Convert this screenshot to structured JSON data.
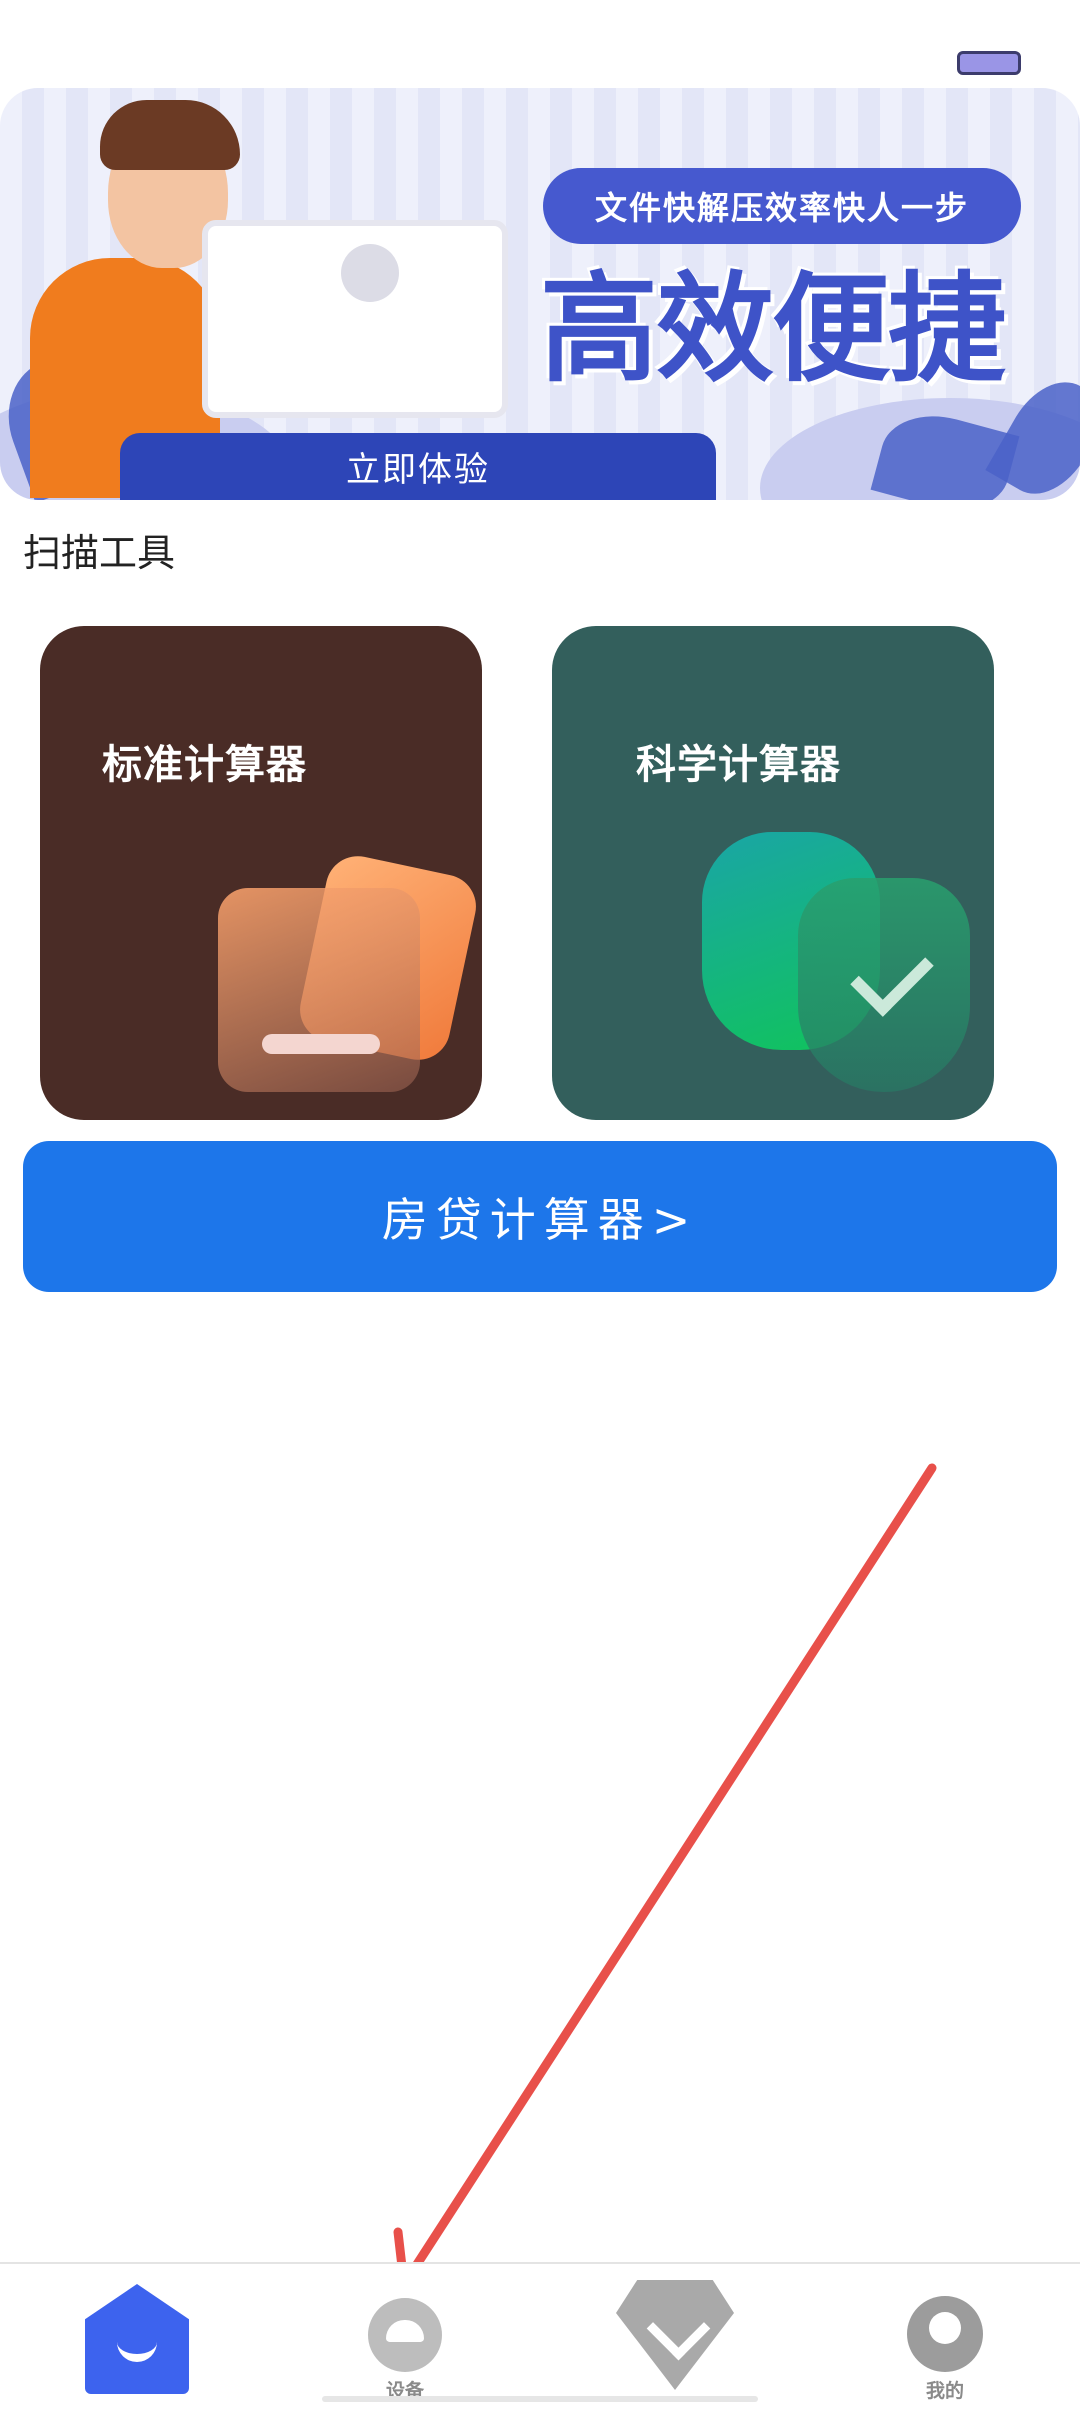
{
  "banner": {
    "tagline": "文件快解压效率快人一步",
    "headline": "高效便捷",
    "cta_label": "立即体验"
  },
  "section": {
    "title": "扫描工具"
  },
  "cards": [
    {
      "label": "标准计算器",
      "icon": "folder-icon"
    },
    {
      "label": "科学计算器",
      "icon": "shield-check-icon"
    }
  ],
  "mortgage_button": {
    "label": "房贷计算器>"
  },
  "tabbar": {
    "items": [
      {
        "label": "",
        "icon": "home-icon",
        "active": true
      },
      {
        "label": "设备",
        "icon": "device-icon",
        "active": false
      },
      {
        "label": "",
        "icon": "diamond-icon",
        "active": false
      },
      {
        "label": "我的",
        "icon": "profile-icon",
        "active": false
      }
    ]
  },
  "colors": {
    "accent_blue": "#1d76ea",
    "tab_active": "#3d63ee",
    "card_standard": "#4a2c26",
    "card_scientific": "#335f5c",
    "annotation_arrow": "#e8504a"
  }
}
